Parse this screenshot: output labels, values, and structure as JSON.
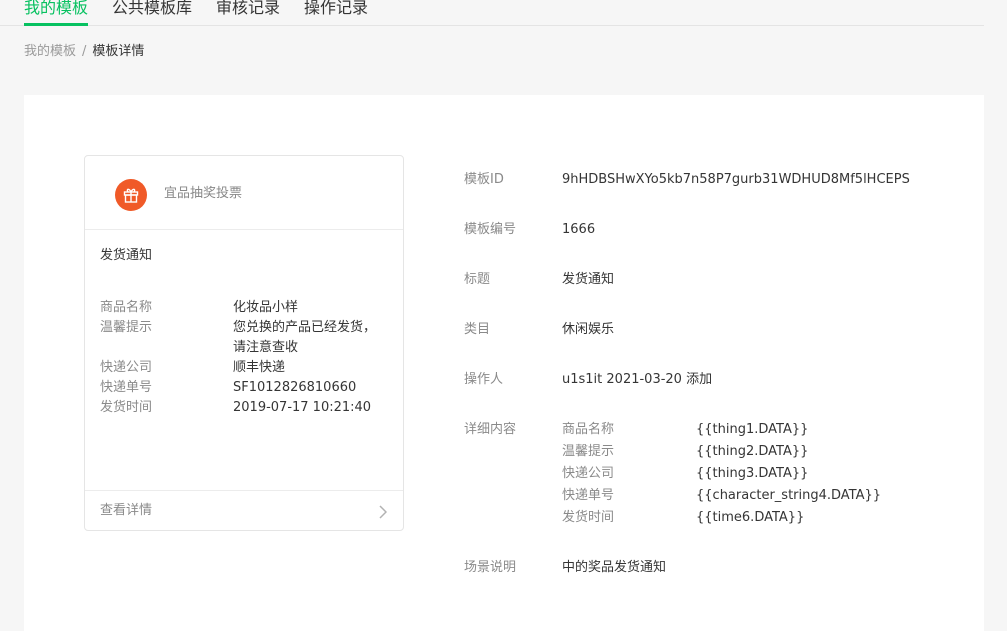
{
  "tabs": [
    {
      "label": "我的模板"
    },
    {
      "label": "公共模板库"
    },
    {
      "label": "审核记录"
    },
    {
      "label": "操作记录"
    }
  ],
  "breadcrumb": {
    "parent": "我的模板",
    "separator": "/",
    "current": "模板详情"
  },
  "preview": {
    "account_name": "宜品抽奖投票",
    "title": "发货通知",
    "fields": [
      {
        "key": "商品名称",
        "value": "化妆品小样"
      },
      {
        "key": "温馨提示",
        "value": "您兑换的产品已经发货，请注意查收"
      },
      {
        "key": "快递公司",
        "value": "顺丰快递"
      },
      {
        "key": "快递单号",
        "value": "SF1012826810660"
      },
      {
        "key": "发货时间",
        "value": "2019-07-17 10:21:40"
      }
    ],
    "detail_link": "查看详情"
  },
  "info": {
    "template_id_label": "模板ID",
    "template_id": "9hHDBSHwXYo5kb7n58P7gurb31WDHUD8Mf5lHCEPS",
    "template_no_label": "模板编号",
    "template_no": "1666",
    "title_label": "标题",
    "title": "发货通知",
    "category_label": "类目",
    "category": "休闲娱乐",
    "operator_label": "操作人",
    "operator": "u1s1it 2021-03-20 添加",
    "detail_label": "详细内容",
    "detail_fields": [
      {
        "key": "商品名称",
        "value": "{{thing1.DATA}}"
      },
      {
        "key": "温馨提示",
        "value": "{{thing2.DATA}}"
      },
      {
        "key": "快递公司",
        "value": "{{thing3.DATA}}"
      },
      {
        "key": "快递单号",
        "value": "{{character_string4.DATA}}"
      },
      {
        "key": "发货时间",
        "value": "{{time6.DATA}}"
      }
    ],
    "scene_label": "场景说明",
    "scene": "中的奖品发货通知"
  },
  "colors": {
    "accent": "#07c160",
    "logo": "#f05a28"
  },
  "icons": {
    "logo": "gift-icon",
    "detail": "chevron-right-icon"
  }
}
